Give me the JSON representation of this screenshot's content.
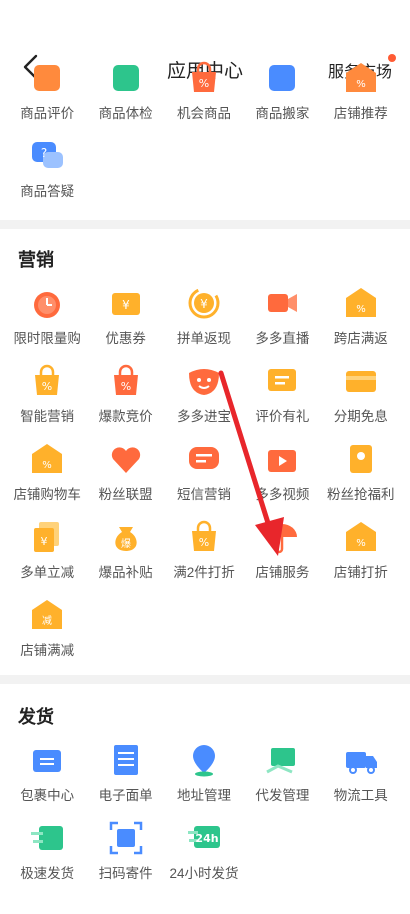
{
  "header": {
    "title": "应用中心",
    "market_label": "服务市场"
  },
  "section_top": {
    "items": [
      {
        "label": "商品评价",
        "icon": "star-comment-icon",
        "color": "#ff8a3d"
      },
      {
        "label": "商品体检",
        "icon": "check-icon",
        "color": "#2dc58c"
      },
      {
        "label": "机会商品",
        "icon": "search-bag-icon",
        "color": "#ff6a3d"
      },
      {
        "label": "商品搬家",
        "icon": "move-icon",
        "color": "#4a8cff"
      },
      {
        "label": "店铺推荐",
        "icon": "shop-recommend-icon",
        "color": "#ff8a3d"
      },
      {
        "label": "商品答疑",
        "icon": "question-chat-icon",
        "color": "#4a8cff"
      }
    ]
  },
  "marketing": {
    "title": "营销",
    "items": [
      {
        "label": "限时限量购",
        "icon": "alarm-clock-icon",
        "color": "#ff6a3d"
      },
      {
        "label": "优惠券",
        "icon": "coupon-icon",
        "color": "#ffb12b"
      },
      {
        "label": "拼单返现",
        "icon": "cashback-coin-icon",
        "color": "#ffb12b"
      },
      {
        "label": "多多直播",
        "icon": "live-camera-icon",
        "color": "#ff6a3d"
      },
      {
        "label": "跨店满返",
        "icon": "shop-return-icon",
        "color": "#ffb12b"
      },
      {
        "label": "智能营销",
        "icon": "trend-bag-icon",
        "color": "#ffb12b"
      },
      {
        "label": "爆款竞价",
        "icon": "hot-bag-icon",
        "color": "#ff6a3d"
      },
      {
        "label": "多多进宝",
        "icon": "treasure-icon",
        "color": "#ff6a3d"
      },
      {
        "label": "评价有礼",
        "icon": "review-gift-icon",
        "color": "#ffb12b"
      },
      {
        "label": "分期免息",
        "icon": "card-icon",
        "color": "#ffb12b"
      },
      {
        "label": "店铺购物车",
        "icon": "shop-cart-icon",
        "color": "#ffb12b"
      },
      {
        "label": "粉丝联盟",
        "icon": "heart-hands-icon",
        "color": "#ff6a3d"
      },
      {
        "label": "短信营销",
        "icon": "sms-icon",
        "color": "#ff6a3d"
      },
      {
        "label": "多多视频",
        "icon": "video-tv-icon",
        "color": "#ff6a3d"
      },
      {
        "label": "粉丝抢福利",
        "icon": "red-packet-icon",
        "color": "#ffb12b"
      },
      {
        "label": "多单立减",
        "icon": "multi-order-icon",
        "color": "#ffb12b"
      },
      {
        "label": "爆品补贴",
        "icon": "money-bag-icon",
        "color": "#ffb12b"
      },
      {
        "label": "满2件打折",
        "icon": "discount-bag-icon",
        "color": "#ffb12b"
      },
      {
        "label": "店铺服务",
        "icon": "umbrella-icon",
        "color": "#ff6a3d"
      },
      {
        "label": "店铺打折",
        "icon": "shop-discount-icon",
        "color": "#ffb12b"
      },
      {
        "label": "店铺满减",
        "icon": "shop-reduce-icon",
        "color": "#ffb12b"
      }
    ]
  },
  "shipping": {
    "title": "发货",
    "items": [
      {
        "label": "包裹中心",
        "icon": "package-icon",
        "color": "#4a8cff"
      },
      {
        "label": "电子面单",
        "icon": "e-waybill-icon",
        "color": "#4a8cff"
      },
      {
        "label": "地址管理",
        "icon": "location-pin-icon",
        "color": "#4a8cff"
      },
      {
        "label": "代发管理",
        "icon": "dropship-box-icon",
        "color": "#2dc58c"
      },
      {
        "label": "物流工具",
        "icon": "truck-icon",
        "color": "#4a8cff"
      },
      {
        "label": "极速发货",
        "icon": "fast-ship-icon",
        "color": "#2dc58c"
      },
      {
        "label": "扫码寄件",
        "icon": "scan-box-icon",
        "color": "#4a8cff"
      },
      {
        "label": "24小时发货",
        "icon": "24h-truck-icon",
        "color": "#2dc58c"
      }
    ],
    "badge_24h": "24h"
  }
}
